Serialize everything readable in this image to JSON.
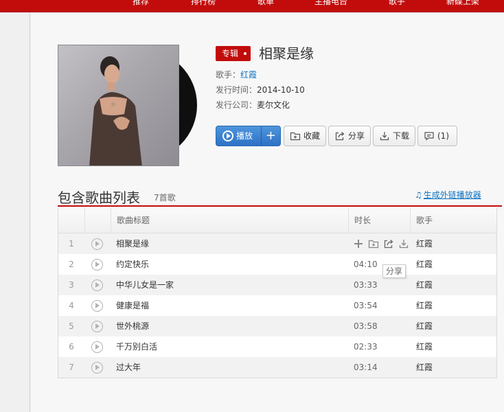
{
  "topnav": {
    "items": [
      "推荐",
      "排行榜",
      "歌单",
      "主播电台",
      "歌手",
      "新碟上架"
    ]
  },
  "album": {
    "badge": "专辑",
    "title": "相聚是缘",
    "singer_label": "歌手：",
    "singer": "红霞",
    "release_label": "发行时间：",
    "release_date": "2014-10-10",
    "company_label": "发行公司：",
    "company": "麦尔文化"
  },
  "actions": {
    "play": "播放",
    "add": "+",
    "collect": "收藏",
    "share": "分享",
    "download": "下载",
    "comment": "(1)"
  },
  "songlist": {
    "title": "包含歌曲列表",
    "count": "7首歌",
    "external_link": "生成外链播放器",
    "columns": {
      "title": "歌曲标题",
      "duration": "时长",
      "singer": "歌手"
    },
    "rows": [
      {
        "num": "1",
        "name": "相聚是缘",
        "duration": "",
        "singer": "红霞"
      },
      {
        "num": "2",
        "name": "约定快乐",
        "duration": "04:10",
        "singer": "红霞"
      },
      {
        "num": "3",
        "name": "中华儿女是一家",
        "duration": "03:33",
        "singer": "红霞"
      },
      {
        "num": "4",
        "name": "健康是福",
        "duration": "03:54",
        "singer": "红霞"
      },
      {
        "num": "5",
        "name": "世外桃源",
        "duration": "03:58",
        "singer": "红霞"
      },
      {
        "num": "6",
        "name": "千万别白活",
        "duration": "02:33",
        "singer": "红霞"
      },
      {
        "num": "7",
        "name": "过大年",
        "duration": "03:14",
        "singer": "红霞"
      }
    ]
  },
  "tooltip": "分享",
  "colors": {
    "brand_red": "#c20c0c",
    "link_blue": "#0c73c2",
    "play_blue": "#2d72c6"
  }
}
